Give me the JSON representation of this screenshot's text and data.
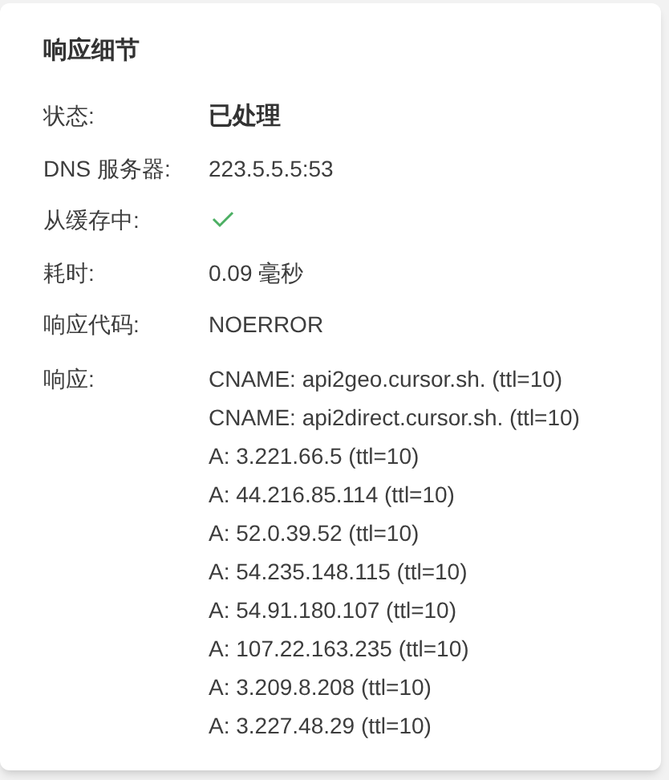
{
  "panel": {
    "title": "响应细节",
    "rows": [
      {
        "label": "状态:",
        "kind": "strong",
        "value": "已处理"
      },
      {
        "label": "DNS 服务器:",
        "kind": "text",
        "value": "223.5.5.5:53"
      },
      {
        "label": "从缓存中:",
        "kind": "check",
        "checked": true
      },
      {
        "label": "耗时:",
        "kind": "text",
        "value": "0.09 毫秒"
      },
      {
        "label": "响应代码:",
        "kind": "text",
        "value": "NOERROR"
      },
      {
        "label": "响应:",
        "kind": "list",
        "lines": [
          "CNAME: api2geo.cursor.sh. (ttl=10)",
          "CNAME: api2direct.cursor.sh. (ttl=10)",
          "A: 3.221.66.5 (ttl=10)",
          "A: 44.216.85.114 (ttl=10)",
          "A: 52.0.39.52 (ttl=10)",
          "A: 54.235.148.115 (ttl=10)",
          "A: 54.91.180.107 (ttl=10)",
          "A: 107.22.163.235 (ttl=10)",
          "A: 3.209.8.208 (ttl=10)",
          "A: 3.227.48.29 (ttl=10)"
        ]
      }
    ]
  }
}
